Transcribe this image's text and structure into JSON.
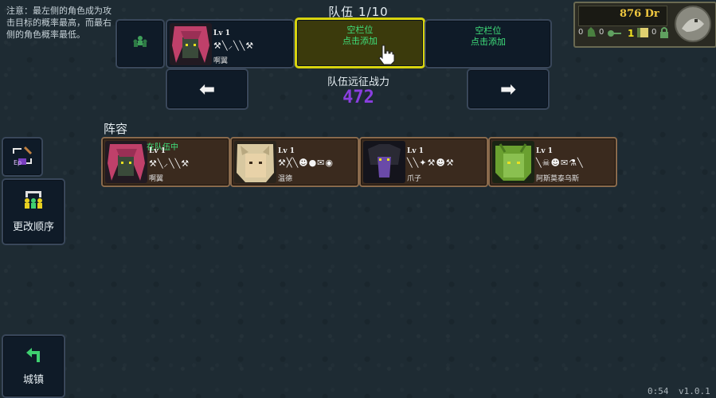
{
  "hint_text": "注意：最左侧的角色成为攻击目标的概率最高，而最右侧的角色概率最低。",
  "team": {
    "title": "队伍 1/10",
    "hero": {
      "level": "Lv 1",
      "name": "啊翼",
      "skills": "⚒╲⸝╲╲⚒"
    },
    "empty_slot_label": "空栏位",
    "empty_slot_action": "点击添加",
    "left_arrow": "⬅",
    "right_arrow": "➡",
    "power_label": "队伍远征战力",
    "power_value": "472"
  },
  "roster": {
    "title": "阵容",
    "cards": [
      {
        "badge": "在队伍中",
        "level": "Lv 1",
        "name": "啊翼",
        "skills": "⚒╲⸝╲╲⚒",
        "portrait_color": "#c0406a",
        "skin": "#3a4a3a"
      },
      {
        "badge": "",
        "level": "Lv 1",
        "name": "温德",
        "skills": "⚒╳╲☻●✉◉",
        "portrait_color": "#d8c8a0",
        "skin": "#e8d2a8"
      },
      {
        "badge": "",
        "level": "Lv 1",
        "name": "爪子",
        "skills": "╲╲✦⚒☻⚒",
        "portrait_color": "#1a1a22",
        "skin": "#6a4aa8"
      },
      {
        "badge": "",
        "level": "Lv 1",
        "name": "阿斯莫泰乌斯",
        "skills": "╲☠☻✉⚗╲",
        "portrait_color": "#6aa030",
        "skin": "#8ac050"
      }
    ]
  },
  "sidebar": {
    "equip_label": "Ep",
    "reorder_label": "更改顺序",
    "town_label": "城镇"
  },
  "resources": {
    "gold": "876 Dr",
    "slot1": "0",
    "slot2": "0",
    "slot3": "1",
    "slot4": "0"
  },
  "footer": {
    "time": "0:54",
    "version": "v1.0.1"
  }
}
